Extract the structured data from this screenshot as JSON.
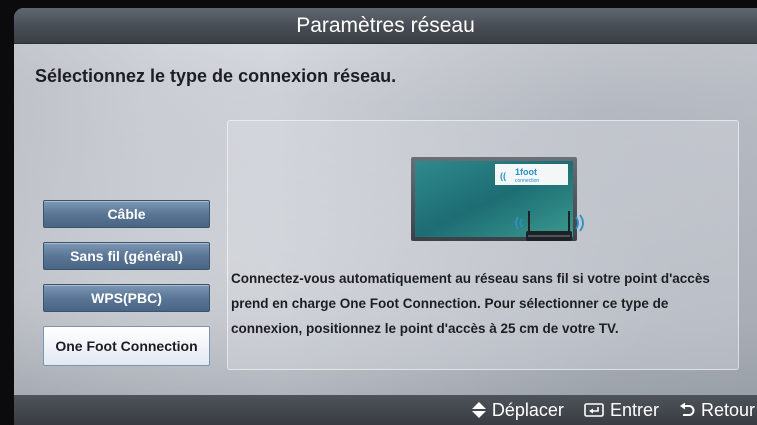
{
  "window": {
    "title": "Paramètres réseau"
  },
  "prompt": "Sélectionnez le type de connexion réseau.",
  "menu": {
    "items": [
      {
        "label": "Câble"
      },
      {
        "label": "Sans fil (général)"
      },
      {
        "label": "WPS(PBC)"
      },
      {
        "label": "One Foot Connection",
        "selected": true
      }
    ]
  },
  "panel": {
    "logo_text": "1foot",
    "logo_subtext": "connection",
    "description": "Connectez-vous automatiquement au réseau sans fil si votre point d'accès prend en charge One Foot Connection. Pour sélectionner ce type de connexion, positionnez le point d'accès à 25 cm de votre TV."
  },
  "footer": {
    "hints": [
      {
        "icon": "up-down-arrow-icon",
        "label": "Déplacer"
      },
      {
        "icon": "enter-icon",
        "label": "Entrer"
      },
      {
        "icon": "return-icon",
        "label": "Retour"
      }
    ]
  },
  "colors": {
    "titlebar": "#474c54",
    "menu_button": "#5a7696",
    "selected_button": "#ffffff",
    "text_dark": "#1c1e22"
  }
}
